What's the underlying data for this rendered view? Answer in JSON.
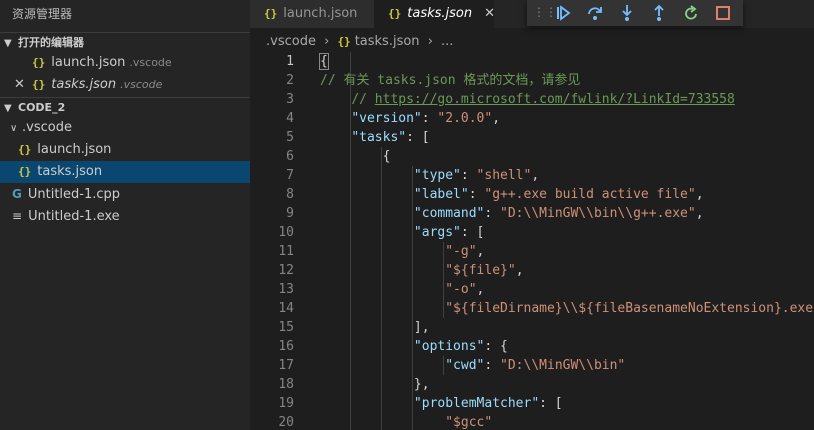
{
  "sidebar": {
    "title": "资源管理器",
    "open_editors": {
      "header": "打开的编辑器",
      "items": [
        {
          "name": "launch.json",
          "desc": ".vscode"
        },
        {
          "name": "tasks.json",
          "desc": ".vscode"
        }
      ]
    },
    "workspace": {
      "header": "CODE_2",
      "folder": ".vscode",
      "folder_items": [
        "launch.json",
        "tasks.json"
      ],
      "files": [
        "Untitled-1.cpp",
        "Untitled-1.exe"
      ]
    }
  },
  "tabs": [
    {
      "label": "launch.json",
      "active": false
    },
    {
      "label": "tasks.json",
      "active": true
    }
  ],
  "debug_toolbar": {
    "buttons": [
      "continue-icon",
      "step-over-icon",
      "step-into-icon",
      "step-out-icon",
      "restart-icon",
      "stop-icon"
    ]
  },
  "breadcrumb": {
    "folder": ".vscode",
    "file": "tasks.json",
    "more": "..."
  },
  "editor": {
    "line_numbers": [
      "1",
      "2",
      "3",
      "4",
      "5",
      "6",
      "7",
      "8",
      "9",
      "10",
      "11",
      "12",
      "13",
      "14",
      "15",
      "16",
      "17",
      "18",
      "19",
      "20"
    ],
    "l1": "{",
    "l2": "// 有关 tasks.json 格式的文档，请参见",
    "l3_prefix": "// ",
    "l3_url": "https://go.microsoft.com/fwlink/?LinkId=733558",
    "l4_key": "\"version\"",
    "l4_val": "\"2.0.0\"",
    "l5_key": "\"tasks\"",
    "l6": "{",
    "l7_key": "\"type\"",
    "l7_val": "\"shell\"",
    "l8_key": "\"label\"",
    "l8_val": "\"g++.exe build active file\"",
    "l9_key": "\"command\"",
    "l9_val": "\"D:\\\\MinGW\\\\bin\\\\g++.exe\"",
    "l10_key": "\"args\"",
    "l11": "\"-g\"",
    "l12": "\"${file}\"",
    "l13": "\"-o\"",
    "l14": "\"${fileDirname}\\\\${fileBasenameNoExtension}.exe\"",
    "l15": "],",
    "l16_key": "\"options\"",
    "l17_key": "\"cwd\"",
    "l17_val": "\"D:\\\\MinGW\\\\bin\"",
    "l18": "},",
    "l19_key": "\"problemMatcher\"",
    "l20": "\"$gcc\""
  },
  "colors": {
    "accent": "#094771",
    "json_icon": "#cbcb41",
    "continue": "#75beff",
    "restart": "#89d185",
    "stop": "#f48771"
  }
}
